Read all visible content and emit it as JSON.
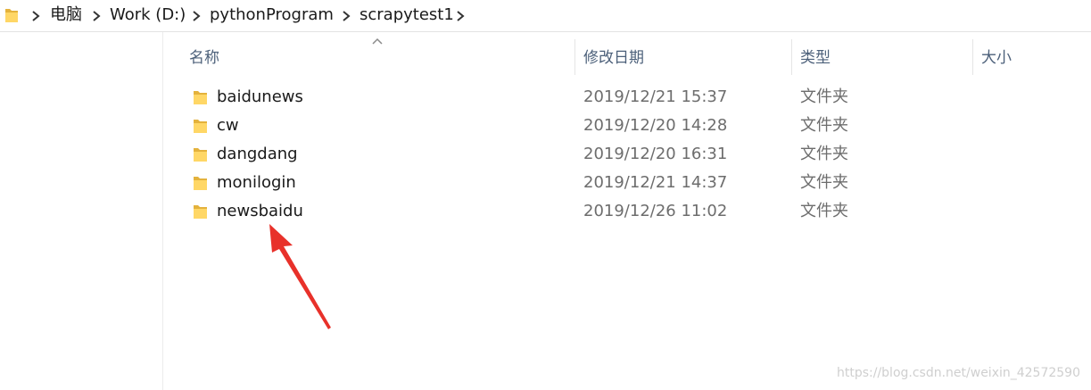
{
  "breadcrumb": {
    "items": [
      {
        "label": "电脑"
      },
      {
        "label": "Work (D:)"
      },
      {
        "label": "pythonProgram"
      },
      {
        "label": "scrapytest1"
      }
    ]
  },
  "columns": {
    "name": "名称",
    "modified": "修改日期",
    "type": "类型",
    "size": "大小",
    "sorted_by": "名称",
    "sort_direction": "ascending"
  },
  "files": [
    {
      "name": "baidunews",
      "modified": "2019/12/21 15:37",
      "type": "文件夹",
      "size": ""
    },
    {
      "name": "cw",
      "modified": "2019/12/20 14:28",
      "type": "文件夹",
      "size": ""
    },
    {
      "name": "dangdang",
      "modified": "2019/12/20 16:31",
      "type": "文件夹",
      "size": ""
    },
    {
      "name": "monilogin",
      "modified": "2019/12/21 14:37",
      "type": "文件夹",
      "size": ""
    },
    {
      "name": "newsbaidu",
      "modified": "2019/12/26 11:02",
      "type": "文件夹",
      "size": ""
    }
  ],
  "annotation": {
    "arrow_points_to": "newsbaidu",
    "arrow_color": "#e8312a"
  },
  "watermark": "https://blog.csdn.net/weixin_42572590",
  "colors": {
    "folder_body": "#f0c350",
    "folder_front": "#ffd766",
    "header_text": "#4c607a",
    "secondary_text": "#6d6d6d"
  },
  "icons": {
    "folder": "folder-icon",
    "separator": "chevron-right-icon",
    "sort": "sort-ascending-caret-icon"
  }
}
